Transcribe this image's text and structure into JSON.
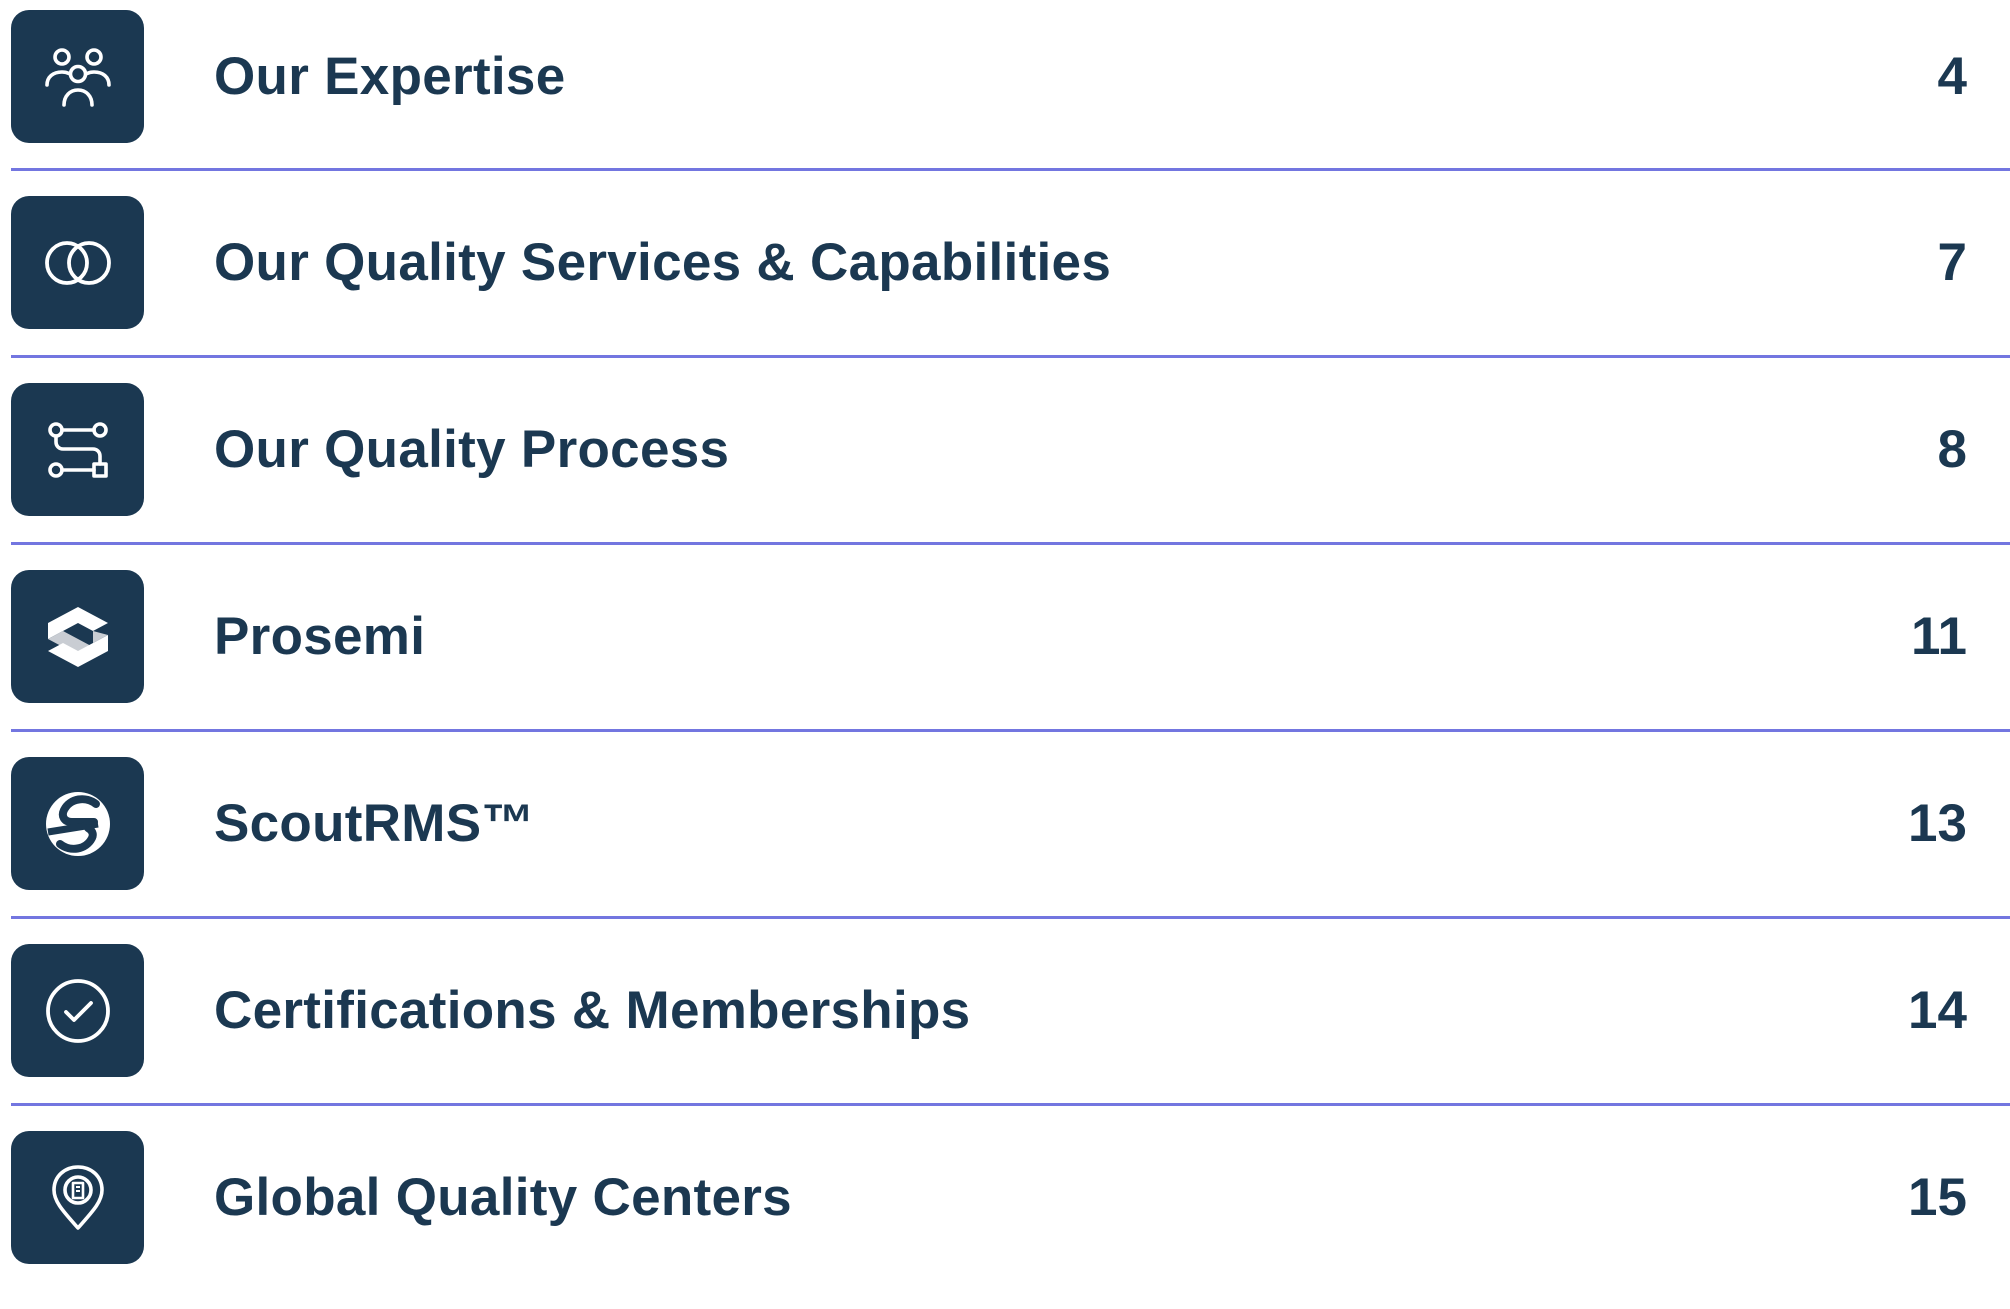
{
  "toc": {
    "accent_color": "#7376e0",
    "tile_color": "#1b3851",
    "text_color": "#1b3851",
    "entries": [
      {
        "title": "Our Expertise",
        "page": "4",
        "icon": "people-group-icon"
      },
      {
        "title": "Our Quality Services & Capabilities",
        "page": "7",
        "icon": "overlapping-circles-icon"
      },
      {
        "title": "Our Quality Process",
        "page": "8",
        "icon": "process-flow-icon"
      },
      {
        "title": "Prosemi",
        "page": "11",
        "icon": "prosemi-logo-icon"
      },
      {
        "title": "ScoutRMS™",
        "page": "13",
        "icon": "scoutrms-logo-icon"
      },
      {
        "title": "Certifications & Memberships",
        "page": "14",
        "icon": "check-circle-icon"
      },
      {
        "title": "Global Quality Centers",
        "page": "15",
        "icon": "location-pin-icon"
      }
    ]
  }
}
